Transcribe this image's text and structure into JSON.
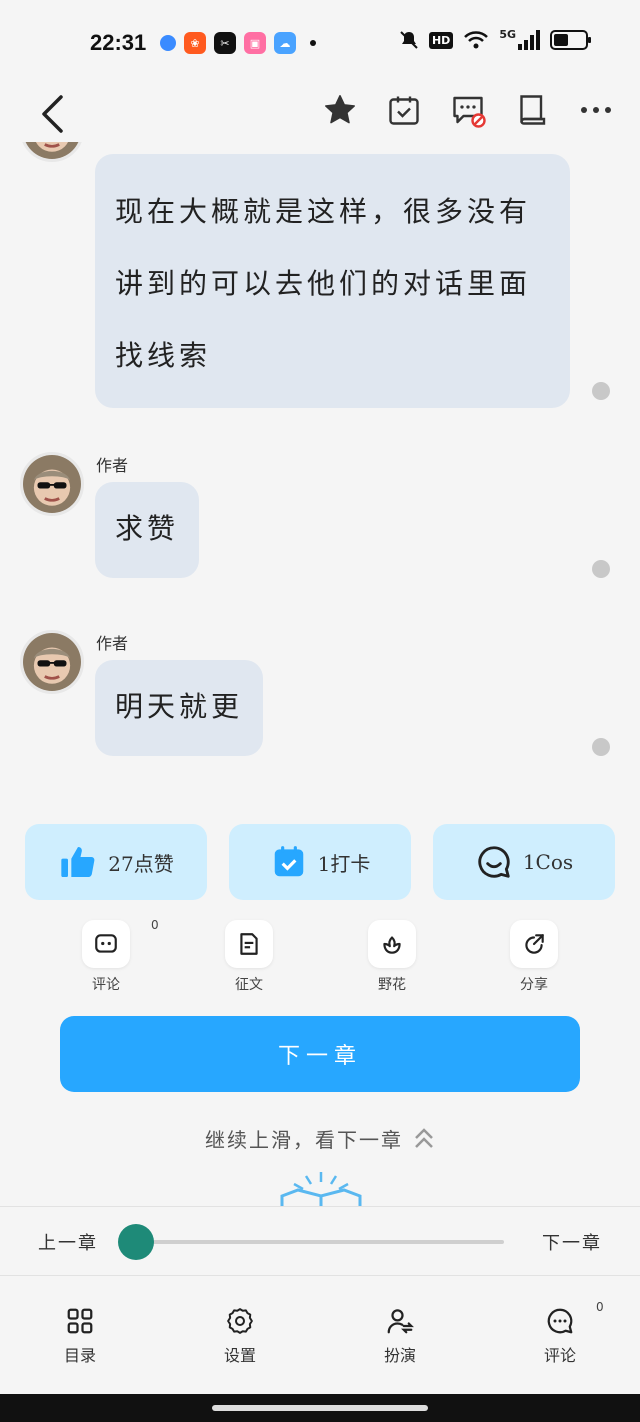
{
  "status_bar": {
    "time": "22:31",
    "network": "5G",
    "hd": "HD",
    "battery_level": 0.45
  },
  "messages": [
    {
      "author": "",
      "text": "现在大概就是这样，很多没有讲到的可以去他们的对话里面找线索"
    },
    {
      "author": "作者",
      "text": "求赞"
    },
    {
      "author": "作者",
      "text": "明天就更"
    }
  ],
  "actions": {
    "like_label": "27点赞",
    "checkin_label": "1打卡",
    "cos_label": "1Cos"
  },
  "tools": {
    "comment_label": "评论",
    "comment_count": "0",
    "essay_label": "征文",
    "flower_label": "野花",
    "share_label": "分享"
  },
  "next_chapter_button": "下一章",
  "swipe_hint": "继续上滑，看下一章",
  "progress": {
    "prev_label": "上一章",
    "next_label": "下一章",
    "value": 0
  },
  "bottom_tabs": {
    "catalog_label": "目录",
    "settings_label": "设置",
    "roleplay_label": "扮演",
    "comment_label": "评论",
    "comment_count": "0"
  },
  "colors": {
    "accent_blue": "#27a7ff",
    "bubble_bg": "#e0e7f0",
    "action_card_bg": "#cfeefe",
    "slider_knob": "#1e8a78"
  }
}
